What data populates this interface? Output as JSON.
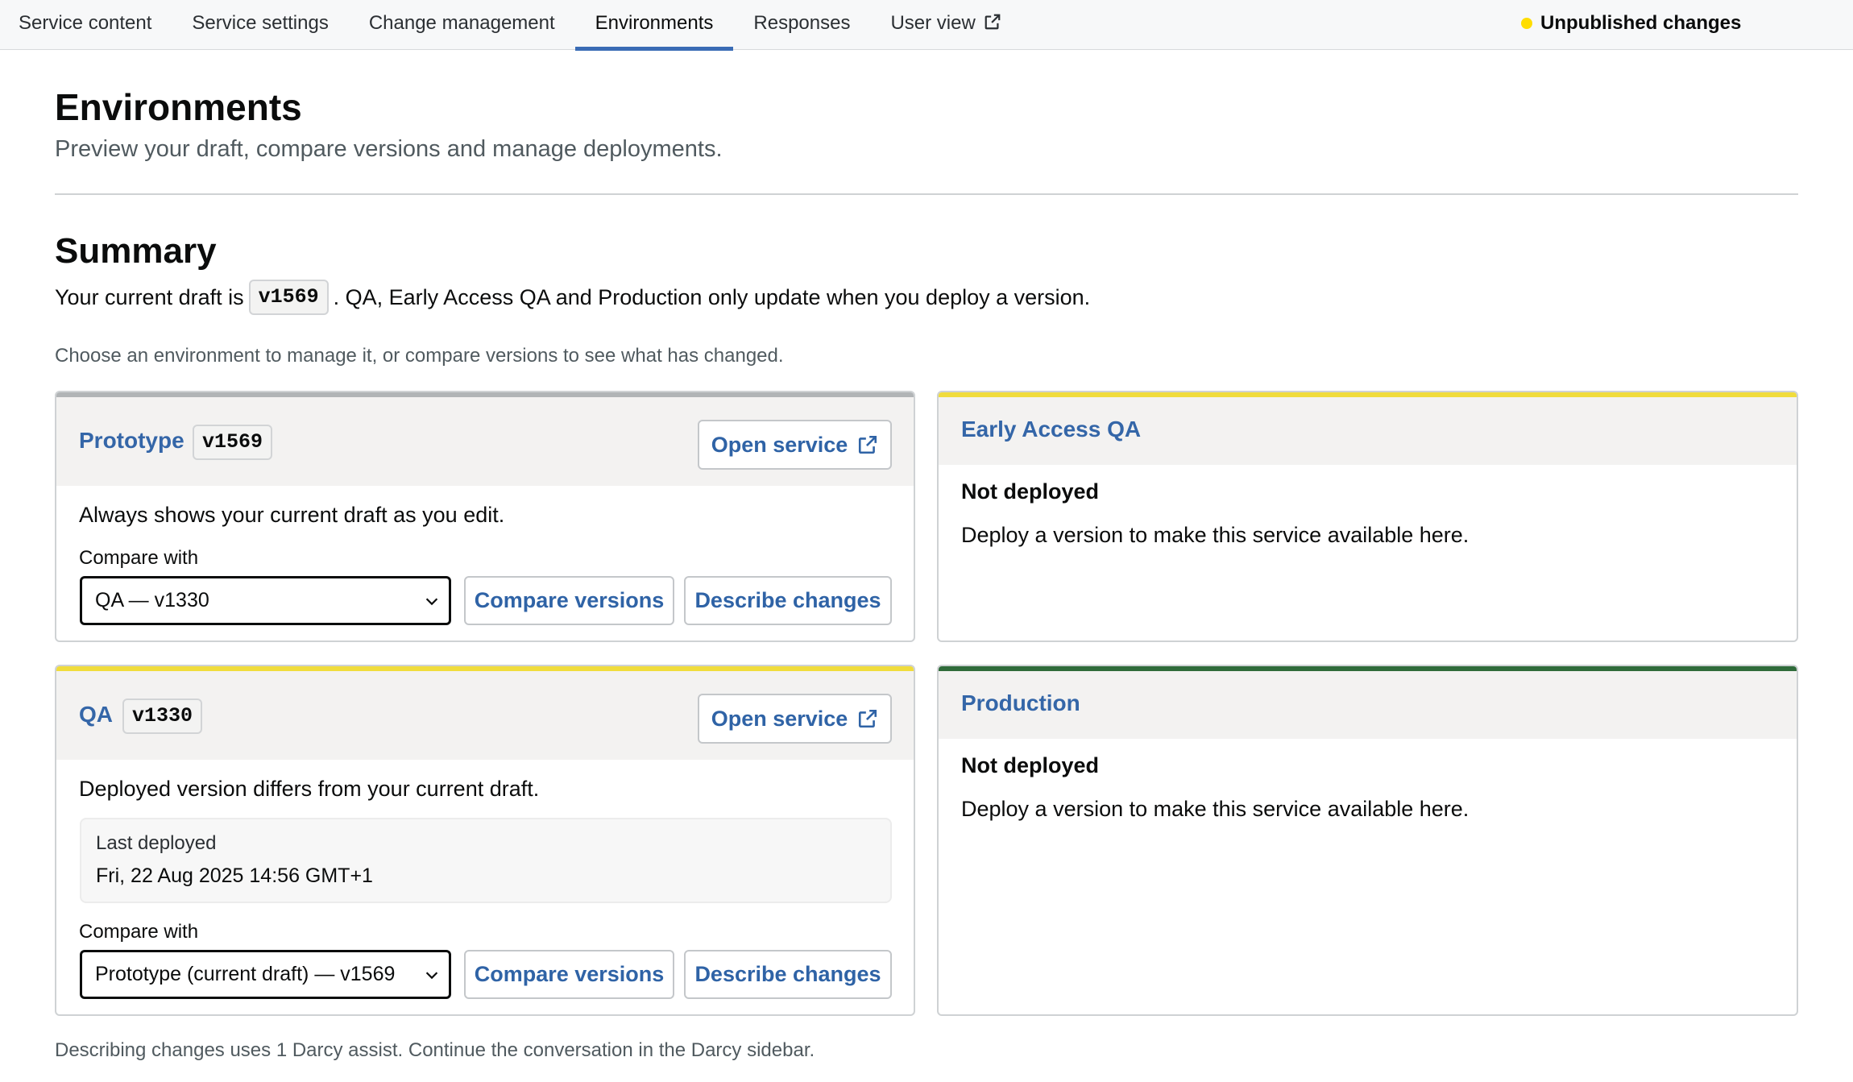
{
  "tabs": [
    {
      "label": "Service content"
    },
    {
      "label": "Service settings"
    },
    {
      "label": "Change management"
    },
    {
      "label": "Environments"
    },
    {
      "label": "Responses"
    },
    {
      "label": "User view"
    }
  ],
  "status": {
    "label": "Unpublished changes",
    "color": "#ffdd00"
  },
  "page": {
    "title": "Environments",
    "subtitle": "Preview your draft, compare versions and manage deployments."
  },
  "summary": {
    "title": "Summary",
    "text_before": "Your current draft is",
    "draft_version": "v1569",
    "text_after": ". QA, Early Access QA and Production only update when you deploy a version.",
    "hint": "Choose an environment to manage it, or compare versions to see what has changed."
  },
  "prototype": {
    "name": "Prototype",
    "version": "v1569",
    "open_label": "Open service",
    "description": "Always shows your current draft as you edit.",
    "compare_label": "Compare with",
    "compare_value": "QA — v1330",
    "compare_button": "Compare versions",
    "describe_button": "Describe changes",
    "bar_color": "#b1b4b6"
  },
  "early_access": {
    "name": "Early Access QA",
    "state": "Not deployed",
    "message": "Deploy a version to make this service available here.",
    "bar_color": "#f0dc3c"
  },
  "qa": {
    "name": "QA",
    "version": "v1330",
    "open_label": "Open service",
    "description": "Deployed version differs from your current draft.",
    "last_deployed_label": "Last deployed",
    "last_deployed_value": "Fri, 22 Aug 2025 14:56 GMT+1",
    "compare_label": "Compare with",
    "compare_value": "Prototype (current draft) — v1569",
    "compare_button": "Compare versions",
    "describe_button": "Describe changes",
    "bar_color": "#f0dc3c"
  },
  "production": {
    "name": "Production",
    "state": "Not deployed",
    "message": "Deploy a version to make this service available here.",
    "bar_color": "#2f6b3a"
  },
  "footer": {
    "note": "Describing changes uses 1 Darcy assist. Continue the conversation in the Darcy sidebar."
  }
}
